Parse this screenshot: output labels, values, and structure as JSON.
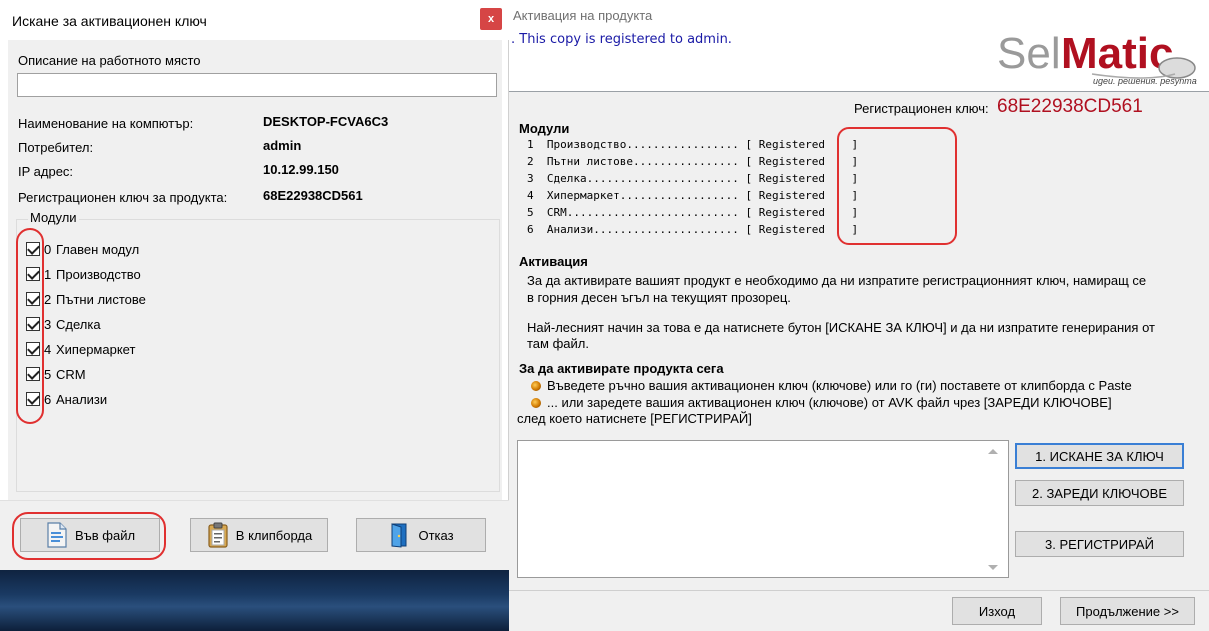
{
  "request_dialog": {
    "title": "Искане за активационен ключ",
    "close_glyph": "x",
    "description_label": "Описание на работното място",
    "description_value": "",
    "fields": [
      {
        "label": "Наименование на компютър:",
        "value": "DESKTOP-FCVA6C3"
      },
      {
        "label": "Потребител:",
        "value": "admin"
      },
      {
        "label": "IP адрес:",
        "value": "10.12.99.150"
      },
      {
        "label": "Регистрационен ключ за продукта:",
        "value": "68E22938CD561"
      }
    ],
    "modules_label": "Модули",
    "modules": [
      {
        "num": "0",
        "name": "Главен модул",
        "checked": true
      },
      {
        "num": "1",
        "name": "Производство",
        "checked": true
      },
      {
        "num": "2",
        "name": "Пътни листове",
        "checked": true
      },
      {
        "num": "3",
        "name": "Сделка",
        "checked": true
      },
      {
        "num": "4",
        "name": "Хипермаркет",
        "checked": true
      },
      {
        "num": "5",
        "name": "CRM",
        "checked": true
      },
      {
        "num": "6",
        "name": "Анализи",
        "checked": true
      }
    ],
    "buttons": {
      "to_file": "Във файл",
      "to_clipboard": "В клипборда",
      "cancel": "Отказ"
    },
    "highlight_color": "#e03030"
  },
  "activation_window": {
    "title": "Активация на продукта",
    "registered_note": ". This copy is registered to  admin.",
    "logo": {
      "brand_a": "Sel",
      "brand_b": "Matic",
      "tagline": "ugeu. решения. pesynmamu."
    },
    "reg_key_label": "Регистрационен ключ:",
    "reg_key_value": "68E22938CD561",
    "modules_heading": "Модули",
    "module_lines": [
      "1  Производство................. [ Registered    ]",
      "2  Пътни листове................ [ Registered    ]",
      "3  Сделка....................... [ Registered    ]",
      "4  Хипермаркет.................. [ Registered    ]",
      "5  CRM.......................... [ Registered    ]",
      "6  Анализи...................... [ Registered    ]"
    ],
    "activation_heading": "Активация",
    "activation_p1_l1": "За да активирате вашият продукт е необходимо да ни изпратите регистрационният ключ, намиращ се",
    "activation_p1_l2": "в горния десен ъгъл на текущият прозорец.",
    "activation_p2_l1": "Най-лесният начин за това е да натиснете бутон [ИСКАНЕ ЗА КЛЮЧ] и да ни изпратите генерирания от",
    "activation_p2_l2": "там файл.",
    "now_heading": "За да активирате продукта сега",
    "bullet1": "Въведете ръчно вашия активационен ключ (ключове) или го (ги) поставете от клипборда с Paste",
    "bullet2": "... или заредете вашия активационен ключ (ключове) от AVK файл чрез [ЗАРЕДИ КЛЮЧОВЕ]",
    "bullet2_cont": "след което натиснете [РЕГИСТРИРАЙ]",
    "key_memo_value": "",
    "buttons": {
      "request_key": "1. ИСКАНЕ ЗА КЛЮЧ",
      "load_keys": "2. ЗАРЕДИ КЛЮЧОВЕ",
      "register": "3. РЕГИСТРИРАЙ",
      "exit": "Изход",
      "continue": "Продължение >>"
    },
    "key_color": "#b01020",
    "note_color": "#1a1aa6"
  }
}
